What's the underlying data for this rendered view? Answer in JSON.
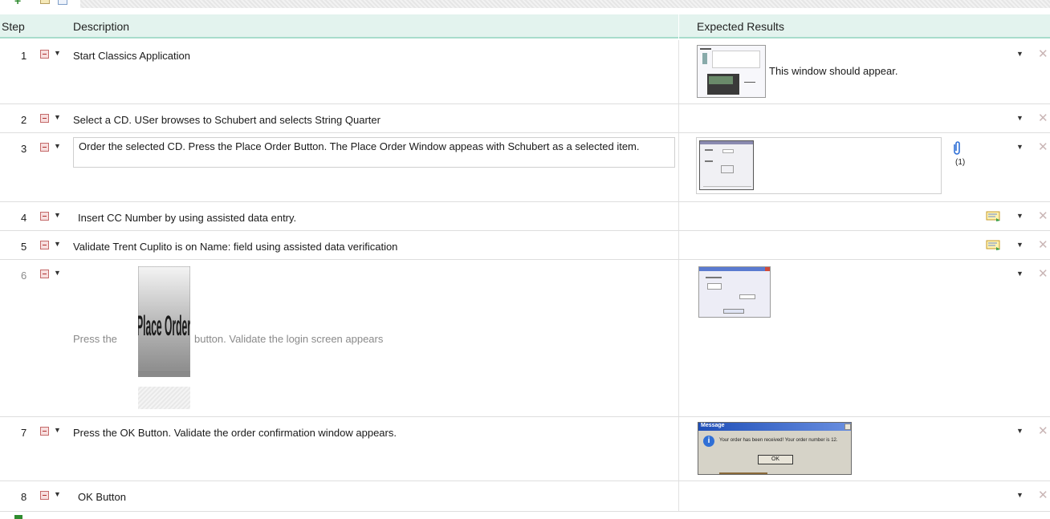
{
  "table": {
    "headers": {
      "step": "Step",
      "description": "Description",
      "expected": "Expected Results"
    }
  },
  "steps": [
    {
      "number": "1",
      "description": "Start Classics Application",
      "expected_text": "This window should appear."
    },
    {
      "number": "2",
      "description": "Select a CD.  USer browses to Schubert  and selects String Quarter"
    },
    {
      "number": "3",
      "description": "Order the selected CD.  Press the Place Order Button.    The Place Order Window appeas with Schubert as a selected item.",
      "attachment_count": "(1)"
    },
    {
      "number": "4",
      "description": "Insert CC Number by using assisted data entry."
    },
    {
      "number": "5",
      "description": "Validate Trent Cuplito is on Name: field using assisted data verification"
    },
    {
      "number": "6",
      "description_before": "Press the",
      "description_after": "button.  Validate the login  screen appears",
      "button_image_text": "Place Order"
    },
    {
      "number": "7",
      "description": "Press the OK Button.  Validate the order confirmation window appears.",
      "dialog": {
        "title": "Message",
        "text": "Your order has been received! Your order number is 12.",
        "ok": "OK"
      }
    },
    {
      "number": "8",
      "description": "OK Button"
    }
  ],
  "icons": {
    "step_type": "step-icon",
    "menu": "chevron-down-icon",
    "delete": "delete-x-icon",
    "data_entry": "assisted-data-icon",
    "attachment": "paperclip-icon"
  },
  "colors": {
    "header_bg": "#e3f3ee",
    "header_border": "#a8dccb",
    "dim_text": "#8a8a8a"
  }
}
